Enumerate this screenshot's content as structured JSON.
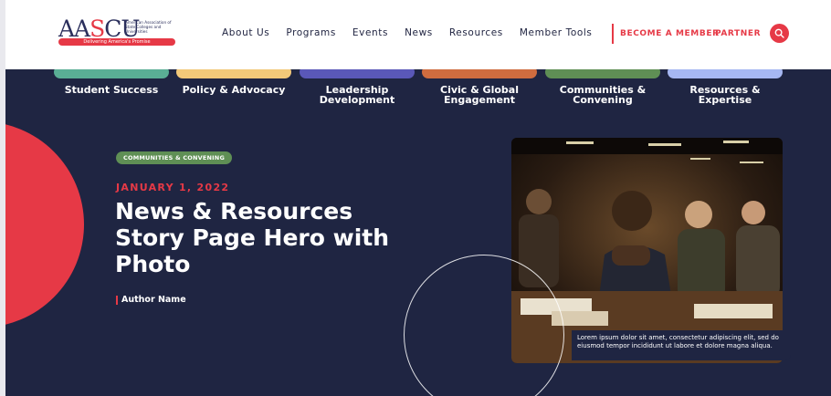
{
  "logo": {
    "word_a": "AA",
    "word_s": "S",
    "word_b": "CU",
    "sub": "American Association of State Colleges and Universities",
    "tagline": "Delivering America's Promise"
  },
  "nav": {
    "items": [
      "About Us",
      "Programs",
      "Events",
      "News",
      "Resources",
      "Member Tools"
    ],
    "become_member": "BECOME A MEMBER",
    "partner": "PARTNER"
  },
  "categories": [
    {
      "label": "Student Success",
      "color": "#5aae95"
    },
    {
      "label": "Policy & Advocacy",
      "color": "#f2c879"
    },
    {
      "label": "Leadership Development",
      "color": "#5a58b8"
    },
    {
      "label": "Civic & Global Engagement",
      "color": "#cf6c3f"
    },
    {
      "label": "Communities & Convening",
      "color": "#5f8f55"
    },
    {
      "label": "Resources & Expertise",
      "color": "#a6b7f2"
    }
  ],
  "hero": {
    "badge": "COMMUNITIES & CONVENING",
    "date": "JANUARY 1, 2022",
    "title": "News & Resources Story Page Hero with Photo",
    "author": "Author Name",
    "caption": "Lorem ipsum dolor sit amet, consectetur adipiscing elit, sed do eiusmod tempor incididunt ut labore et dolore magna aliqua."
  },
  "colors": {
    "navy": "#1f2542",
    "accent_red": "#e63946",
    "brand_navy": "#2b2f5c"
  }
}
